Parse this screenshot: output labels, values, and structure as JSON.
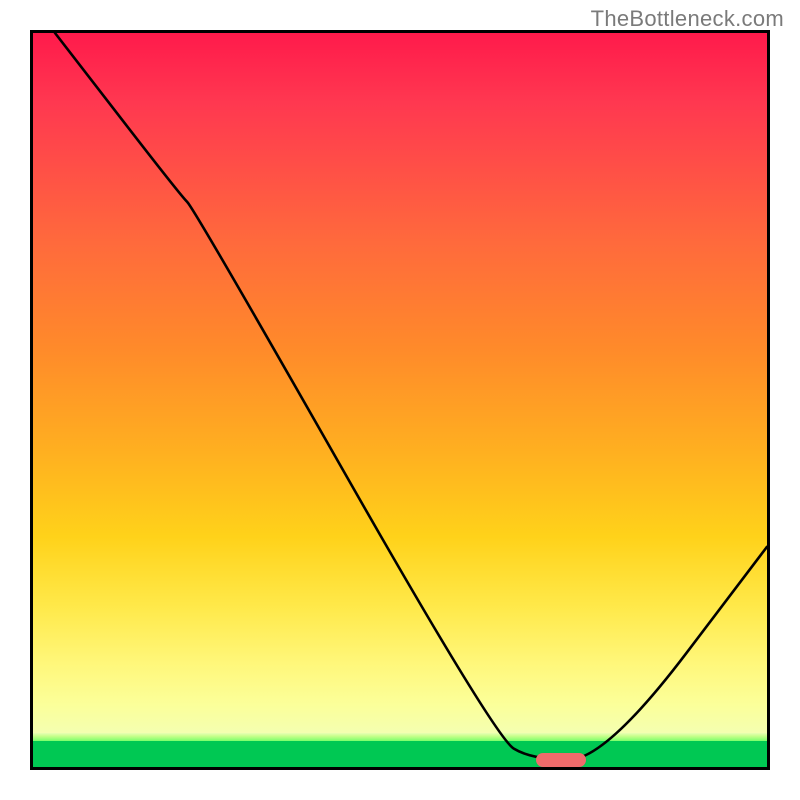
{
  "watermark": "TheBottleneck.com",
  "chart_data": {
    "type": "line",
    "title": "",
    "xlabel": "",
    "ylabel": "",
    "xlim": [
      0,
      100
    ],
    "ylim": [
      0,
      100
    ],
    "series": [
      {
        "name": "curve",
        "x": [
          3,
          20,
          22,
          63,
          68,
          78,
          100
        ],
        "values": [
          100,
          78,
          76,
          4,
          1,
          1,
          30
        ]
      }
    ],
    "gradient_stops": [
      {
        "pos": 0,
        "color": "#ff1a4b"
      },
      {
        "pos": 30,
        "color": "#ff6a3c"
      },
      {
        "pos": 60,
        "color": "#ffb020"
      },
      {
        "pos": 82,
        "color": "#ffe94a"
      },
      {
        "pos": 95,
        "color": "#f4ffb0"
      },
      {
        "pos": 100,
        "color": "#00c853"
      }
    ],
    "marker": {
      "x": 72,
      "y": 1,
      "color": "#ef6b6b"
    }
  }
}
